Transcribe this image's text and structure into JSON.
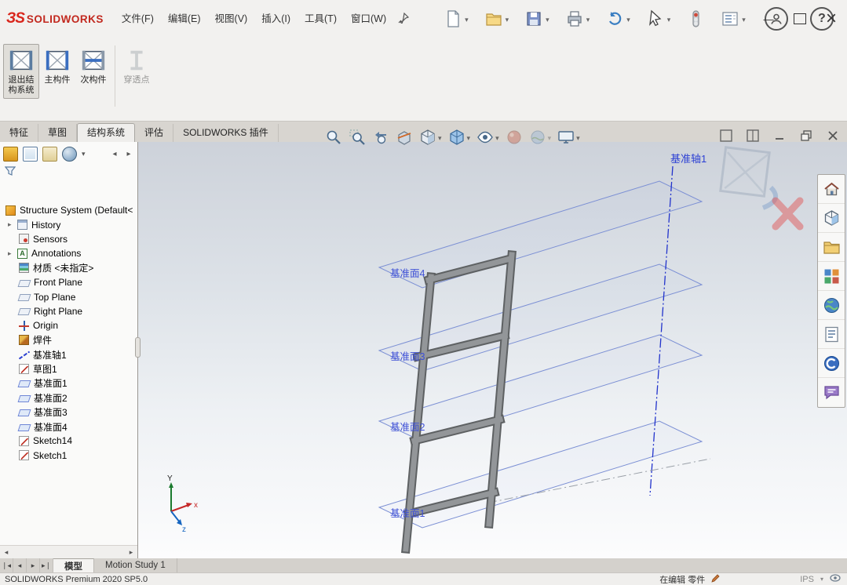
{
  "menubar": {
    "brand_mark": "ЗS",
    "brand": "SOLIDWORKS",
    "menus": [
      "文件(F)",
      "编辑(E)",
      "视图(V)",
      "插入(I)",
      "工具(T)",
      "窗口(W)"
    ]
  },
  "ribbon": {
    "buttons": [
      {
        "label_line1": "退出结",
        "label_line2": "构系统"
      },
      {
        "label": "主构件"
      },
      {
        "label": "次构件"
      },
      {
        "label": "穿透点"
      }
    ]
  },
  "tabs": {
    "items": [
      "特征",
      "草图",
      "结构系统",
      "评估",
      "SOLIDWORKS 插件"
    ],
    "active": "结构系统"
  },
  "tree": {
    "items": [
      {
        "label": "Structure System (Default<"
      },
      {
        "label": "History"
      },
      {
        "label": "Sensors"
      },
      {
        "label": "Annotations"
      },
      {
        "label": "材质 <未指定>"
      },
      {
        "label": "Front Plane"
      },
      {
        "label": "Top Plane"
      },
      {
        "label": "Right Plane"
      },
      {
        "label": "Origin"
      },
      {
        "label": "焊件"
      },
      {
        "label": "基准轴1"
      },
      {
        "label": "草图1"
      },
      {
        "label": "基准面1"
      },
      {
        "label": "基准面2"
      },
      {
        "label": "基准面3"
      },
      {
        "label": "基准面4"
      },
      {
        "label": "Sketch14"
      },
      {
        "label": "Sketch1"
      }
    ]
  },
  "viewport": {
    "axis_label": "基准轴1",
    "planes": [
      {
        "label": "基准面4"
      },
      {
        "label": "基准面3"
      },
      {
        "label": "基准面2"
      },
      {
        "label": "基准面1"
      }
    ],
    "triad": {
      "x": "x",
      "y": "Y",
      "z": "z"
    }
  },
  "doc_tabs": {
    "items": [
      "模型",
      "Motion Study 1"
    ],
    "active": "模型"
  },
  "statusbar": {
    "left": "SOLIDWORKS Premium 2020 SP5.0",
    "editing": "在编辑 零件",
    "units": "IPS"
  },
  "icons": {
    "filter": "funnel",
    "pin": "pushpin",
    "help": "?",
    "confirmation_accept": "structure-frame",
    "confirmation_cancel": "red-x"
  },
  "colors": {
    "brand_red": "#d9261c",
    "plane_blue": "#7b8fd4",
    "axis_blue": "#2233cc",
    "member_gray": "#8c8c8c"
  }
}
